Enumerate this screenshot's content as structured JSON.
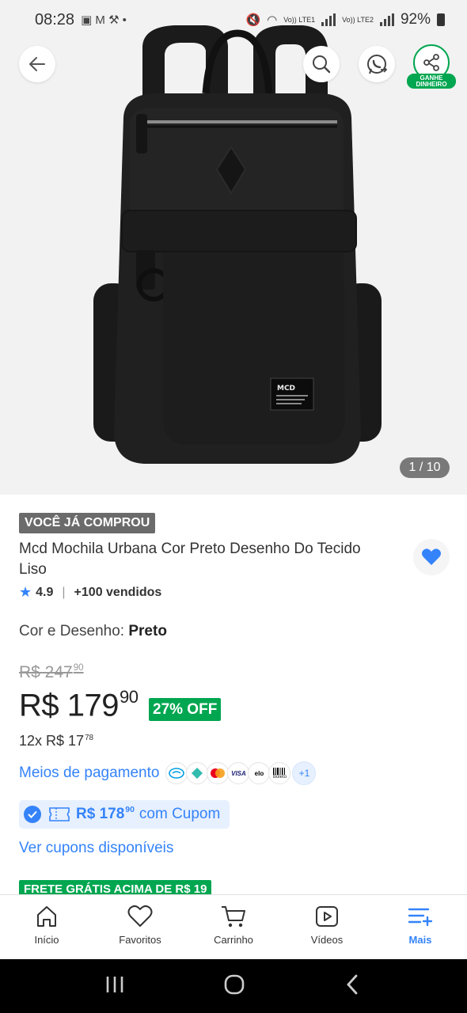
{
  "status_bar": {
    "time": "08:28",
    "network_1": "Vo)) LTE1",
    "network_2": "Vo)) LTE2",
    "battery": "92%"
  },
  "hero": {
    "logo_text": "MCD",
    "image_counter": "1 / 10",
    "share_badge": "GANHE DINHEIRO"
  },
  "product": {
    "purchased_tag": "VOCÊ JÁ COMPROU",
    "title": "Mcd Mochila Urbana Cor Preto Desenho Do Tecido Liso",
    "rating": "4.9",
    "sold": "+100 vendidos",
    "variant_label": "Cor e Desenho: ",
    "variant_value": "Preto",
    "old_price": "R$ 247",
    "old_price_cents": "90",
    "price": "R$ 179",
    "price_cents": "90",
    "discount": "27% OFF",
    "installments": "12x R$ 17",
    "installments_cents": "78",
    "payment_link": "Meios de pagamento",
    "payment_more": "+1",
    "coupon_price": "R$ 178",
    "coupon_price_cents": "90",
    "coupon_text": "com Cupom",
    "see_coupons": "Ver cupons disponíveis",
    "shipping_tag": "FRETE GRÁTIS ACIMA DE R$ 19"
  },
  "payment_methods": [
    "mercado-pago",
    "pix",
    "mastercard",
    "visa",
    "elo",
    "boleto"
  ],
  "payment_labels": {
    "visa": "VISA",
    "elo": "elo",
    "boleto": "Boleto"
  },
  "bottom_nav": [
    {
      "label": "Início",
      "icon": "home-icon"
    },
    {
      "label": "Favoritos",
      "icon": "heart-icon"
    },
    {
      "label": "Carrinho",
      "icon": "cart-icon"
    },
    {
      "label": "Vídeos",
      "icon": "video-icon"
    },
    {
      "label": "Mais",
      "icon": "menu-plus-icon",
      "active": true
    }
  ],
  "colors": {
    "accent_blue": "#3483fa",
    "green": "#00a650",
    "hero_bg": "#f2f2f2",
    "tag_gray": "#6b6b6b"
  }
}
